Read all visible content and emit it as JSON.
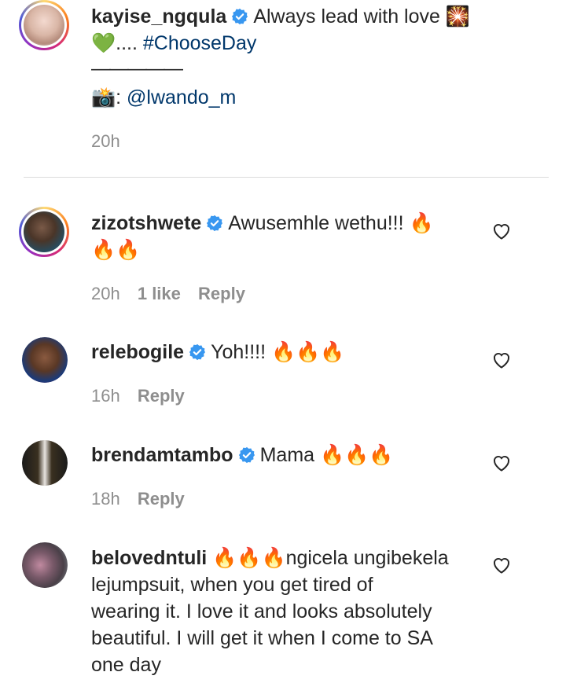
{
  "caption": {
    "username": "kayise_ngqula",
    "text_line1": "Always lead with love 🎇",
    "text_line2_prefix": "💚.... ",
    "hashtag": "#ChooseDay",
    "dashes": "—————",
    "credit_prefix": "📸: ",
    "credit_mention": "@lwando_m",
    "time": "20h"
  },
  "comments": [
    {
      "username": "zizotshwete",
      "verified": true,
      "text_line1": "Awusemhle wethu!!! 🔥",
      "text_line2": "🔥🔥",
      "time": "20h",
      "likes": "1 like",
      "reply": "Reply"
    },
    {
      "username": "relebogile",
      "verified": true,
      "text_line1": "Yoh!!!! 🔥🔥🔥",
      "time": "16h",
      "reply": "Reply"
    },
    {
      "username": "brendamtambo",
      "verified": true,
      "text_line1": "Mama 🔥🔥🔥",
      "time": "18h",
      "reply": "Reply"
    },
    {
      "username": "belovedntuli",
      "verified": false,
      "text_line1": "🔥🔥🔥ngicela ungibekela",
      "text_line2": "lejumpsuit, when you get tired of",
      "text_line3": "wearing it. I love it and looks absolutely",
      "text_line4": "beautiful. I will get it when I come to SA",
      "text_line5": "one day"
    }
  ],
  "icons": {
    "verified": "verified-badge-icon",
    "like": "heart-outline-icon"
  },
  "colors": {
    "text": "#262626",
    "meta": "#8e8e8e",
    "link": "#00376b",
    "verified": "#3897f0"
  }
}
